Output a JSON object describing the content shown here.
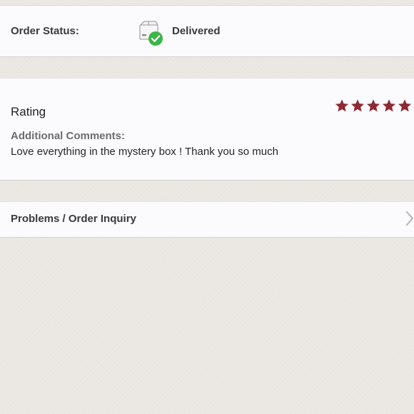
{
  "order_status": {
    "label": "Order Status:",
    "value": "Delivered",
    "icon": "delivered-box-icon",
    "check_color": "#3cb54a"
  },
  "rating": {
    "label": "Rating",
    "stars": 5,
    "max_stars": 5,
    "star_color": "#8e2a35",
    "comments_label": "Additional Comments:",
    "comments": "Love everything in the mystery box ! Thank you so much"
  },
  "inquiry": {
    "label": "Problems / Order Inquiry",
    "icon": "chevron-right-icon"
  }
}
